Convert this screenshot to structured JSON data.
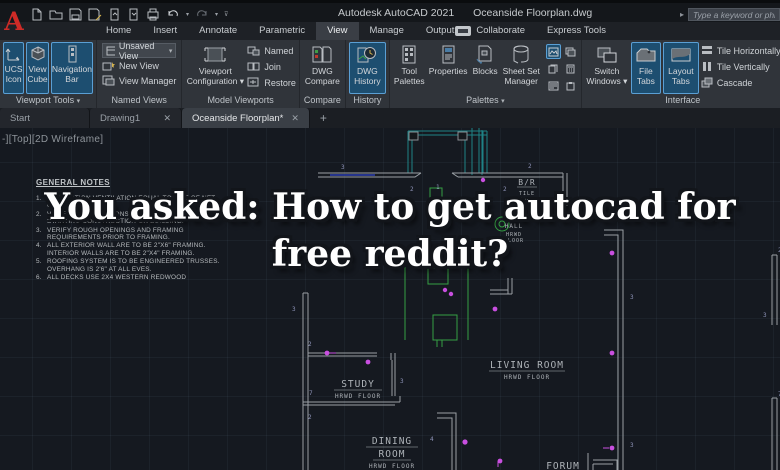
{
  "titlebar": {
    "app_title": "Autodesk AutoCAD 2021",
    "doc_title": "Oceanside Floorplan.dwg",
    "search_placeholder": "Type a keyword or phrase"
  },
  "ribbon_tabs": {
    "items": [
      "Home",
      "Insert",
      "Annotate",
      "Parametric",
      "View",
      "Manage",
      "Output",
      "Collaborate",
      "Express Tools"
    ]
  },
  "ribbon": {
    "viewport_tools": {
      "label": "Viewport Tools",
      "ucs": "UCS Icon",
      "cube": "View Cube",
      "navbar": "Navigation Bar"
    },
    "named_views": {
      "label": "Named Views",
      "combo": "Unsaved View",
      "new_view": "New View",
      "view_manager": "View Manager"
    },
    "model_viewports": {
      "label": "Model Viewports",
      "config": "Viewport Configuration",
      "named": "Named",
      "join": "Join",
      "restore": "Restore"
    },
    "compare": {
      "label": "Compare",
      "big": "DWG Compare"
    },
    "history": {
      "label": "History",
      "big": "DWG History"
    },
    "palettes": {
      "label": "Palettes",
      "tool": "Tool Palettes",
      "properties": "Properties",
      "blocks": "Blocks",
      "sheetset": "Sheet Set Manager"
    },
    "interface": {
      "label": "Interface",
      "switch": "Switch Windows",
      "file_tabs": "File Tabs",
      "layout_tabs": "Layout Tabs",
      "tile_h": "Tile Horizontally",
      "tile_v": "Tile Vertically",
      "cascade": "Cascade"
    }
  },
  "file_tabs": {
    "start": "Start",
    "drawing1": "Drawing1",
    "active": "Oceanside Floorplan*"
  },
  "canvas": {
    "viewport_control": "-][Top][2D Wireframe]",
    "notes_title": "GENERAL NOTES",
    "notes": [
      {
        "n": "1.",
        "t": "FOUNDATION VENTILATION EQUAL TO SIZE OF NET OPENINGS 0 S."
      },
      {
        "n": "2.",
        "t": "VERIFY ALL DIMENSIONS AND CONDITIONS BEFORE STARTING CONSTRUCTION OR BUILDING."
      },
      {
        "n": "3.",
        "t": "VERIFY ROUGH OPENINGS AND FRAMING REQUIREMENTS PRIOR TO FRAMING."
      },
      {
        "n": "4.",
        "t": "ALL EXTERIOR WALL ARE TO BE 2\"X6\" FRAMING. INTERIOR WALLS ARE TO BE 2\"X4\" FRAMING."
      },
      {
        "n": "5.",
        "t": "ROOFING SYSTEM IS TO BE ENGINEERED TRUSSES. OVERHANG IS 2'6\" AT ALL EVES."
      },
      {
        "n": "6.",
        "t": "ALL DECKS USE 2X4 WESTERN REDWOOD"
      }
    ],
    "overlay": {
      "line1": "You asked: How to get autocad for",
      "line2": "free reddit?"
    },
    "labels": {
      "br": "B/R",
      "br_tile": "TILE",
      "br_floor": "FLOOR",
      "hall": "HALL",
      "hall_hrwd": "HRWD",
      "hall_floor": "FLOOR",
      "living": "LIVING ROOM",
      "living_floor": "HRWD FLOOR",
      "study": "STUDY",
      "study_floor": "HRWD FLOOR",
      "dining1": "DINING",
      "dining2": "ROOM",
      "dining_floor": "HRWD FLOOR",
      "forum": "FORUM"
    },
    "tags": [
      "3",
      "2",
      "1",
      "2",
      "2",
      "3",
      "2",
      "7",
      "2",
      "3",
      "4",
      "3",
      "3",
      "3",
      "2",
      "7"
    ],
    "accent_colors": {
      "walls": "#9aa0a5",
      "deck": "#1f8286",
      "fixtures": "#35a043",
      "markers": "#c94fe0",
      "blue_line": "#2b3db0"
    }
  }
}
